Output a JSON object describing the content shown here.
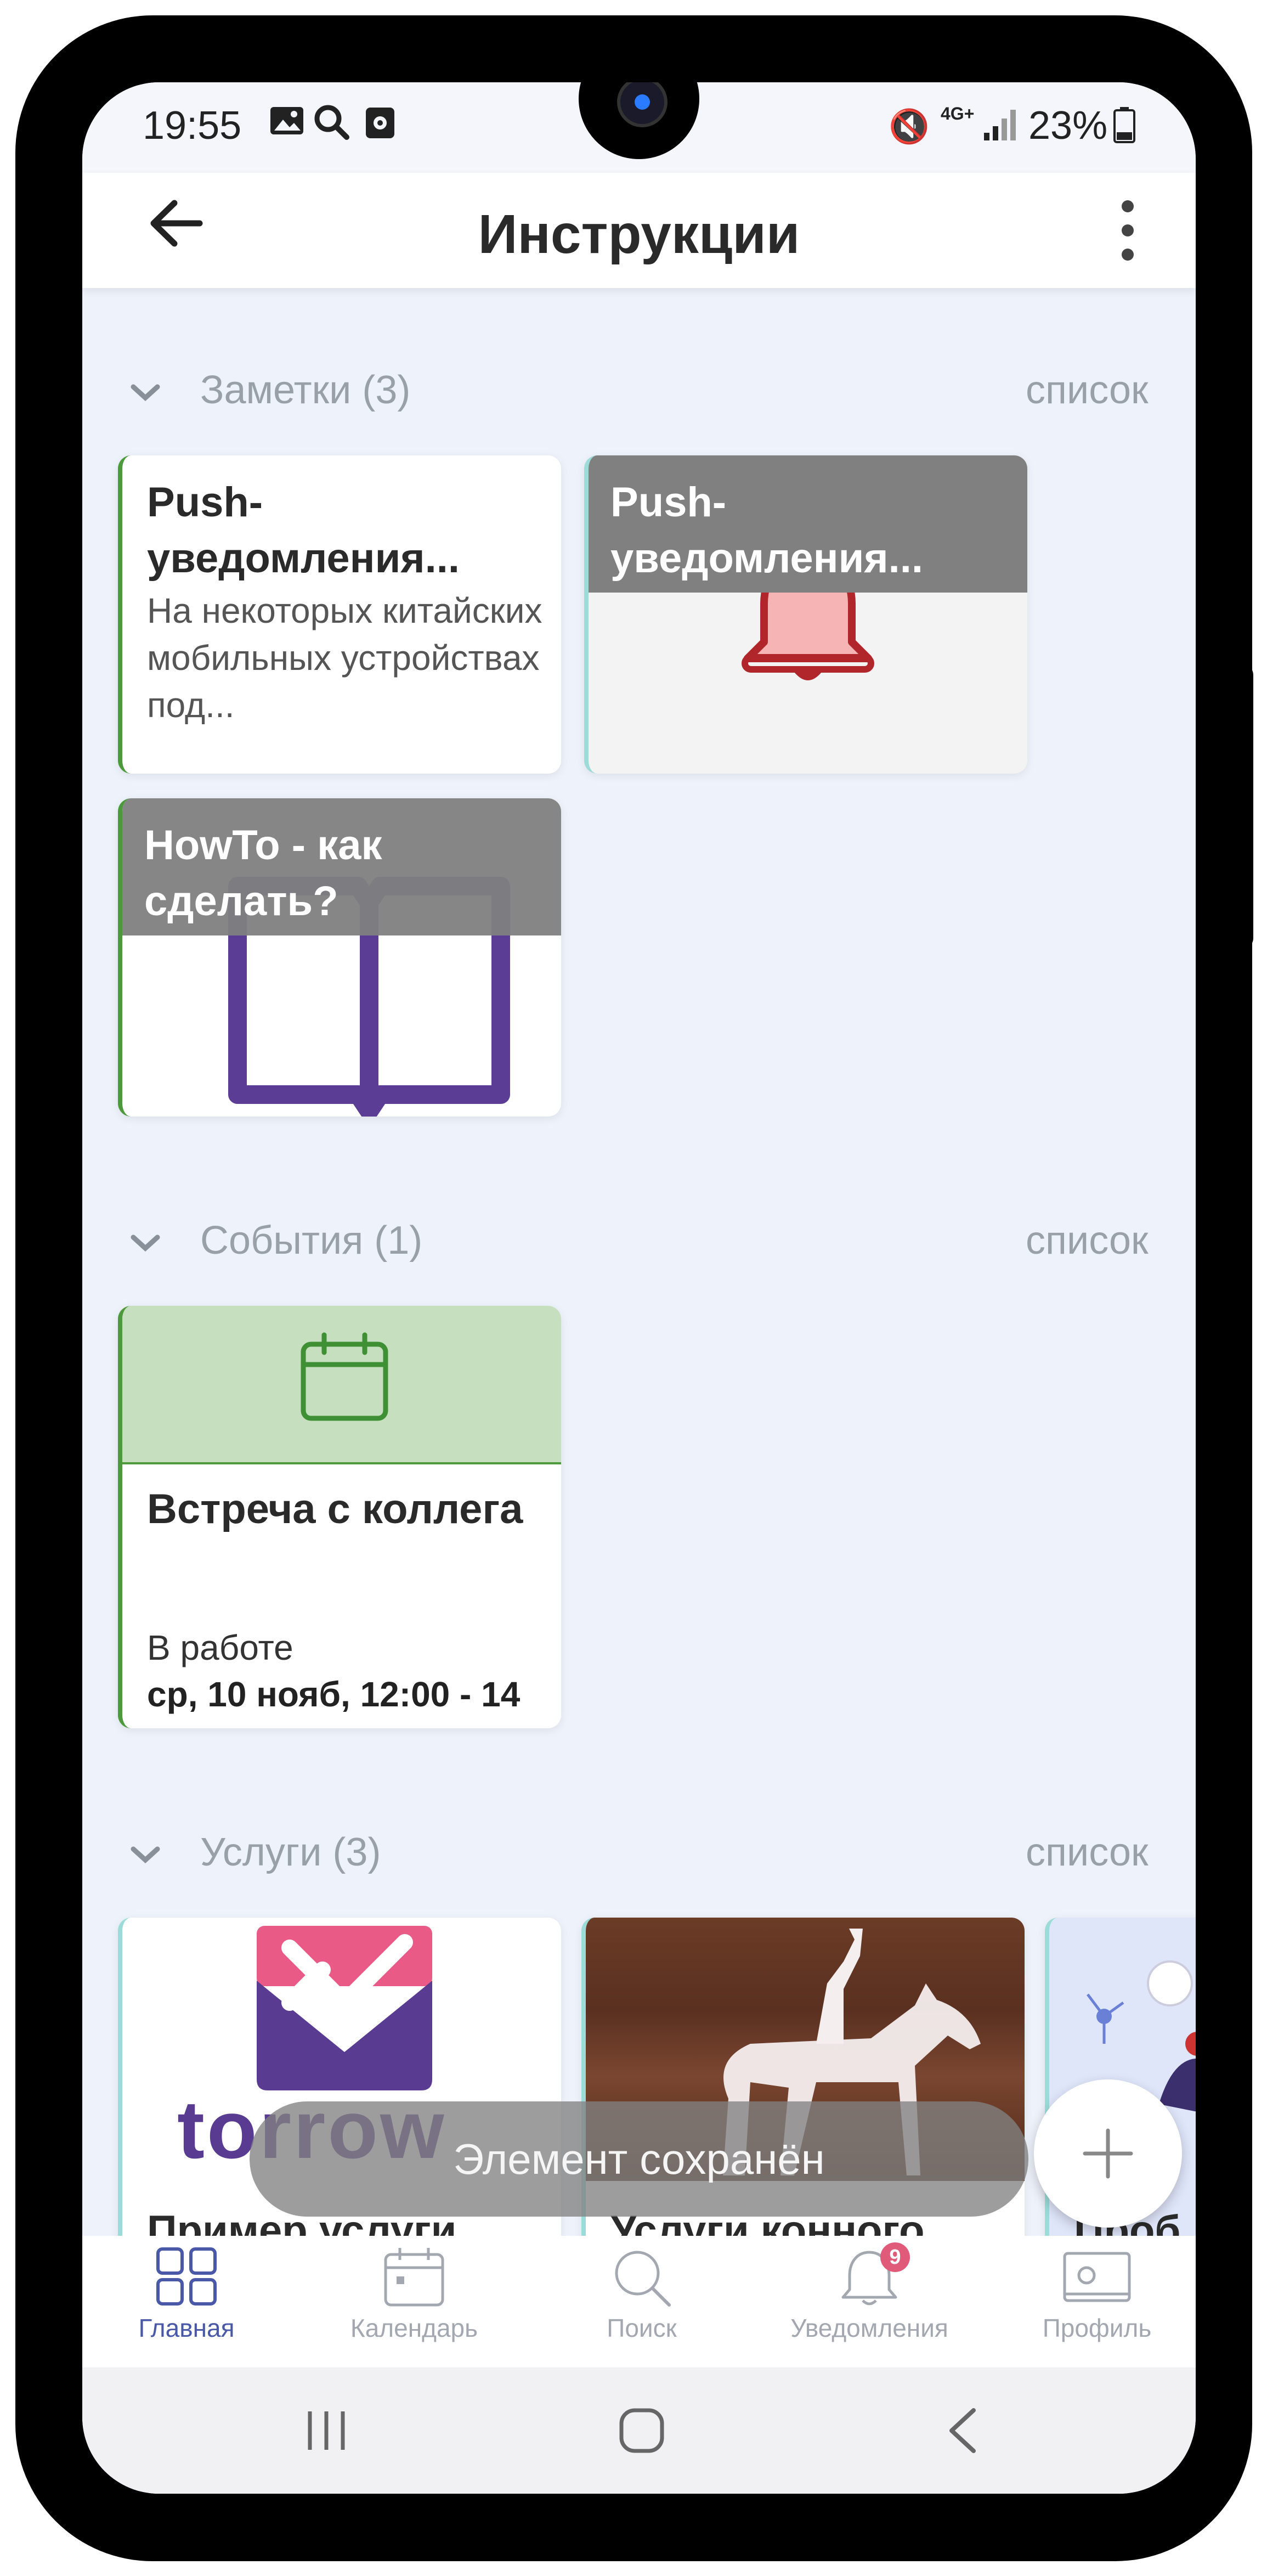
{
  "status_bar": {
    "time": "19:55",
    "battery": "23%",
    "network": "4G+"
  },
  "app_bar": {
    "title": "Инструкции"
  },
  "sections": {
    "notes": {
      "title": "Заметки (3)",
      "view_link": "список",
      "cards": [
        {
          "title": "Push-уведомления...",
          "text": "На некоторых китайских мобильных устройствах под..."
        },
        {
          "title": "Push-уведомления...",
          "image": "bell-icon"
        },
        {
          "title": "HowTo - как сделать?",
          "image": "book-icon"
        }
      ]
    },
    "events": {
      "title": "События (1)",
      "view_link": "список",
      "cards": [
        {
          "title": "Встреча с коллега",
          "status": "В работе",
          "datetime": "ср, 10 нояб, 12:00 - 14"
        }
      ]
    },
    "services": {
      "title": "Услуги (3)",
      "view_link": "список",
      "cards": [
        {
          "title": "Пример услуги",
          "logo_text": "torrow"
        },
        {
          "title": "Услуги конного"
        },
        {
          "title": "Проб"
        }
      ]
    }
  },
  "toast": {
    "text": "Элемент сохранён"
  },
  "bottom_nav": {
    "items": [
      {
        "label": "Главная",
        "icon": "grid-icon",
        "active": true
      },
      {
        "label": "Календарь",
        "icon": "calendar-icon"
      },
      {
        "label": "Поиск",
        "icon": "search-icon"
      },
      {
        "label": "Уведомления",
        "icon": "bell-icon",
        "badge": "9"
      },
      {
        "label": "Профиль",
        "icon": "profile-card-icon"
      }
    ]
  },
  "colors": {
    "accent_green": "#4c9a3c",
    "nav_active": "#4a58a8",
    "event_header": "#c6dfbe",
    "bell_red": "#b0262a",
    "book_purple": "#5b3d96",
    "torrow_pink": "#e95b86",
    "torrow_purple": "#5a3b92"
  }
}
